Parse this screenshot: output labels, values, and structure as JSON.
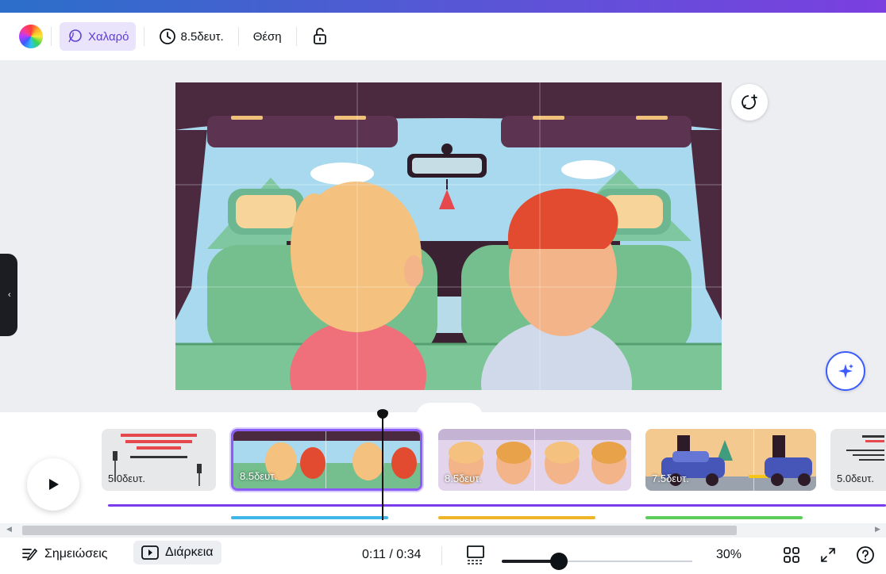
{
  "toolbar": {
    "color_icon": "color-wheel-icon",
    "animation_label": "Χαλαρό",
    "duration_label": "8.5δευτ.",
    "position_label": "Θέση",
    "lock_icon": "unlock-icon"
  },
  "canvas": {
    "comment_icon": "add-comment-icon",
    "magic_icon": "sparkle-icon",
    "collapse_icon": "chevron-down-icon",
    "side_handle_icon": "chevron-left-icon"
  },
  "timeline": {
    "play_icon": "play-icon",
    "clips": [
      {
        "duration": "5.0δευτ."
      },
      {
        "duration": "8.5δευτ."
      },
      {
        "duration": "8.5δευτ."
      },
      {
        "duration": "7.5δευτ."
      },
      {
        "duration": "5.0δευτ."
      }
    ],
    "track_colors": [
      "#3fb5e8",
      "#f0b429",
      "#5ccf5a"
    ],
    "audio_color": "#7c3aed",
    "selected_clip": 2
  },
  "bottombar": {
    "notes_label": "Σημειώσεις",
    "duration_label": "Διάρκεια",
    "time_current": "0:11",
    "time_separator": " / ",
    "time_total": "0:34",
    "zoom_value": 0.3,
    "zoom_label": "30%"
  },
  "colors": {
    "accent": "#8b5cf6",
    "gradient_start": "#2b6fc9",
    "gradient_end": "#7b3fe0"
  }
}
